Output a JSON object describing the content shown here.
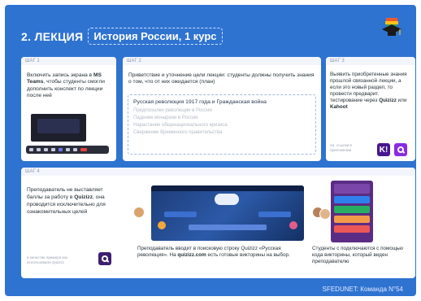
{
  "header": {
    "title": "2. ЛЕКЦИЯ",
    "subtitle": "История России, 1 курс",
    "icon": "graduation-cap-icon"
  },
  "step1": {
    "label": "ШАГ 1",
    "text_part1": "Включить запись экрана в ",
    "text_bold": "MS Teams",
    "text_part2": ", чтобы студенты смогли дополнить конспект по лекции после неё"
  },
  "step2": {
    "label": "ШАГ 2",
    "text": "Приветствие и уточнение цели лекции: студенты должны получить знания о том, что от них ожидается (план)",
    "topic": "Русская революция 1917 года и Гражданская война",
    "items": [
      "Предпосылки революции в России",
      "Падение монархии в России",
      "Нарастание общенационального кризиса",
      "Свержение Временного правительства"
    ]
  },
  "step3": {
    "label": "ШАГ 3",
    "text_part1": "Выявить приобретенные знания прошлой связанной лекции, а если это новый раздел, то провести предварит. тестирование через ",
    "quizizz": "Quizizz",
    "or": " или ",
    "kahoot": "Kahoot",
    "note": "см. ссылки в приложении",
    "logos": [
      "kahoot-logo",
      "quizizz-logo"
    ]
  },
  "step4": {
    "label": "ШАГ 4",
    "text_part1": "Преподаватель не выставляет баллы за работу в ",
    "text_bold": "Quizizz",
    "text_part2": ", она проводится исключительно для ознакомительных целей",
    "note": "в качестве примера мы использовали Quizizz",
    "caption_mid_part1": "Преподаватель вводит в поисковую строку Quizizz «Русская революция». На ",
    "caption_mid_bold": "quizizz.com",
    "caption_mid_part2": " есть готовые викторины на выбор.",
    "caption_right": "Студенты с подключаются с помощью кода викторины, который виден преподавателю"
  },
  "footer": {
    "team": "SFEDUNET: Команда N°54"
  },
  "colors": {
    "background": "#2f73d1",
    "card": "#ffffff",
    "quizizz": "#8a2be2",
    "kahoot": "#46178f"
  }
}
